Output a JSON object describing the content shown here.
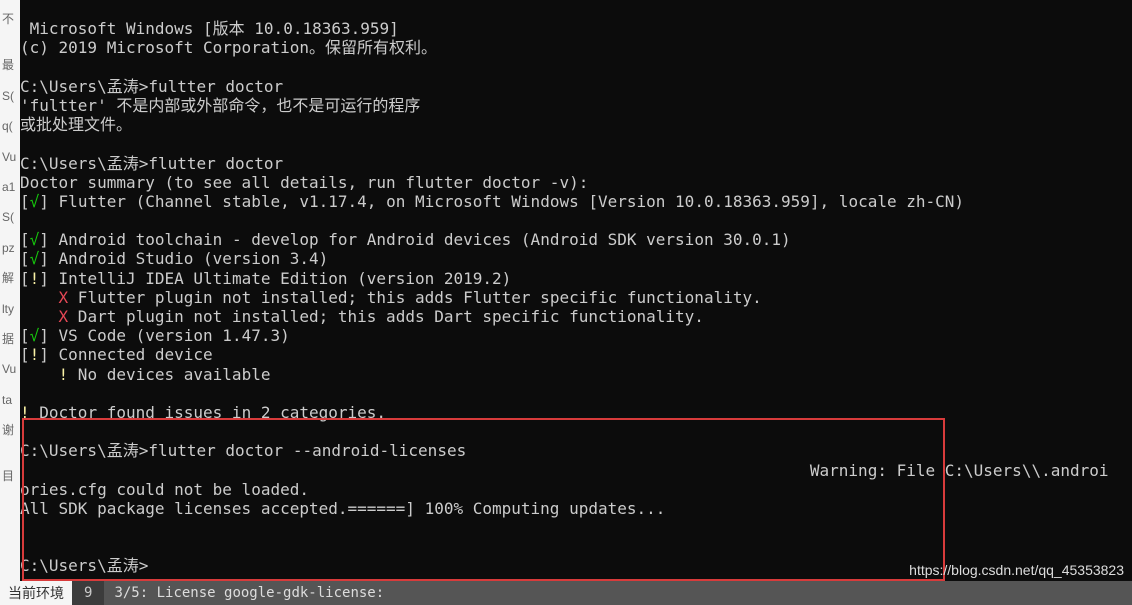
{
  "sidebar": {
    "items": [
      "不",
      " ",
      "最",
      "S(",
      "q(",
      "Vu",
      "a1",
      "S(",
      "pz",
      "解",
      "lty",
      "据",
      "Vu",
      "ta",
      "谢",
      " ",
      "目"
    ]
  },
  "terminal": {
    "lines": [
      {
        "segments": [
          {
            "text": " Microsoft Windows [版本 10.0.18363.959]",
            "cls": "white"
          }
        ]
      },
      {
        "segments": [
          {
            "text": "(c) 2019 Microsoft Corporation。保留所有权利。",
            "cls": "white"
          }
        ]
      },
      {
        "segments": [
          {
            "text": "",
            "cls": "white"
          }
        ]
      },
      {
        "segments": [
          {
            "text": "C:\\Users\\孟涛>fultter doctor",
            "cls": "white"
          }
        ]
      },
      {
        "segments": [
          {
            "text": "'fultter' 不是内部或外部命令，也不是可运行的程序",
            "cls": "white"
          }
        ]
      },
      {
        "segments": [
          {
            "text": "或批处理文件。",
            "cls": "white"
          }
        ]
      },
      {
        "segments": [
          {
            "text": "",
            "cls": "white"
          }
        ]
      },
      {
        "segments": [
          {
            "text": "C:\\Users\\孟涛>flutter doctor",
            "cls": "white"
          }
        ]
      },
      {
        "segments": [
          {
            "text": "Doctor summary (to see all details, run flutter doctor -v):",
            "cls": "white"
          }
        ]
      },
      {
        "segments": [
          {
            "text": "[",
            "cls": "white"
          },
          {
            "text": "√",
            "cls": "green"
          },
          {
            "text": "] Flutter (Channel stable, v1.17.4, on Microsoft Windows [Version 10.0.18363.959], locale zh-CN)",
            "cls": "white"
          }
        ]
      },
      {
        "segments": [
          {
            "text": "",
            "cls": "white"
          }
        ]
      },
      {
        "segments": [
          {
            "text": "[",
            "cls": "white"
          },
          {
            "text": "√",
            "cls": "green"
          },
          {
            "text": "] Android toolchain - develop for Android devices (Android SDK version 30.0.1)",
            "cls": "white"
          }
        ]
      },
      {
        "segments": [
          {
            "text": "[",
            "cls": "white"
          },
          {
            "text": "√",
            "cls": "green"
          },
          {
            "text": "] Android Studio (version 3.4)",
            "cls": "white"
          }
        ]
      },
      {
        "segments": [
          {
            "text": "[",
            "cls": "white"
          },
          {
            "text": "!",
            "cls": "yellow"
          },
          {
            "text": "] IntelliJ IDEA Ultimate Edition (version 2019.2)",
            "cls": "white"
          }
        ]
      },
      {
        "segments": [
          {
            "text": "    ",
            "cls": "white"
          },
          {
            "text": "X",
            "cls": "red"
          },
          {
            "text": " Flutter plugin not installed; this adds Flutter specific functionality.",
            "cls": "white"
          }
        ]
      },
      {
        "segments": [
          {
            "text": "    ",
            "cls": "white"
          },
          {
            "text": "X",
            "cls": "red"
          },
          {
            "text": " Dart plugin not installed; this adds Dart specific functionality.",
            "cls": "white"
          }
        ]
      },
      {
        "segments": [
          {
            "text": "[",
            "cls": "white"
          },
          {
            "text": "√",
            "cls": "green"
          },
          {
            "text": "] VS Code (version 1.47.3)",
            "cls": "white"
          }
        ]
      },
      {
        "segments": [
          {
            "text": "[",
            "cls": "white"
          },
          {
            "text": "!",
            "cls": "yellow"
          },
          {
            "text": "] Connected device",
            "cls": "white"
          }
        ]
      },
      {
        "segments": [
          {
            "text": "    ",
            "cls": "white"
          },
          {
            "text": "!",
            "cls": "yellow"
          },
          {
            "text": " No devices available",
            "cls": "white"
          }
        ]
      },
      {
        "segments": [
          {
            "text": "",
            "cls": "white"
          }
        ]
      },
      {
        "segments": [
          {
            "text": "!",
            "cls": "yellow"
          },
          {
            "text": " Doctor found issues in 2 categories.",
            "cls": "white"
          }
        ]
      },
      {
        "segments": [
          {
            "text": "",
            "cls": "white"
          }
        ]
      },
      {
        "segments": [
          {
            "text": "C:\\Users\\孟涛>flutter doctor --android-licenses",
            "cls": "white"
          }
        ]
      },
      {
        "segments": [
          {
            "text": "                                                                                  Warning: File C:\\Users\\\\.androi",
            "cls": "white"
          }
        ]
      },
      {
        "segments": [
          {
            "text": "ories.cfg could not be loaded.",
            "cls": "white"
          }
        ]
      },
      {
        "segments": [
          {
            "text": "All SDK package licenses accepted.======] 100% Computing updates...",
            "cls": "white"
          }
        ]
      },
      {
        "segments": [
          {
            "text": "",
            "cls": "white"
          }
        ]
      },
      {
        "segments": [
          {
            "text": "",
            "cls": "white"
          }
        ]
      },
      {
        "segments": [
          {
            "text": "C:\\Users\\孟涛>",
            "cls": "white"
          }
        ]
      }
    ]
  },
  "watermark": "https://blog.csdn.net/qq_45353823",
  "status": {
    "left": "当前环境",
    "num": "9",
    "right": "3/5: License google-gdk-license:"
  }
}
